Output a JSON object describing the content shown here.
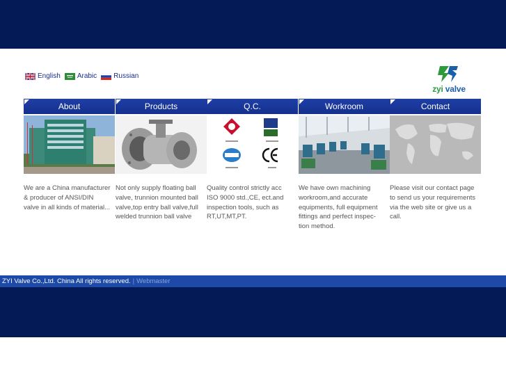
{
  "languages": [
    {
      "label": "English",
      "flag": "uk-flag-icon"
    },
    {
      "label": "Arabic",
      "flag": "saudi-flag-icon"
    },
    {
      "label": "Russian",
      "flag": "russia-flag-icon"
    }
  ],
  "logo": {
    "prefix": "zyi",
    "suffix": "valve"
  },
  "columns": [
    {
      "tab": "About",
      "image": "factory-building-photo",
      "text": "We are a China manufacturer & producer of ANSI/DIN valve in all kinds of material..."
    },
    {
      "tab": "Products",
      "image": "ball-valve-photo",
      "text": "Not only supply floating ball valve, trunnion mounted ball valve,top entry ball valve,full welded trunnion ball valve"
    },
    {
      "tab": "Q.C.",
      "image": "certification-logos",
      "text": "Quality control strictly acc ISO 9000 std.,CE, ect.and inspection tools, such as RT,UT,MT,PT."
    },
    {
      "tab": "Workroom",
      "image": "workshop-photo",
      "text": "We have own machining workroom,and accurate equipments, full equipment fittings and perfect inspec-tion method."
    },
    {
      "tab": "Contact",
      "image": "world-map",
      "text": "Please visit our contact page to send us your requirements via the web site or give us a call."
    }
  ],
  "footer": {
    "copyright": "ZYI Valve Co.,Ltd. China All rights reserved.",
    "separator": "|",
    "webmaster": "Webmaster"
  },
  "colors": {
    "navy": "#031a57",
    "tab_blue": "#1f3fa6",
    "footer_blue": "#1d4aa8",
    "text_gray": "#555555"
  }
}
